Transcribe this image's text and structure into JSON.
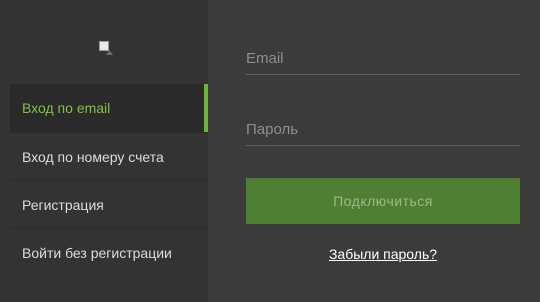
{
  "sidebar": {
    "logo": "broken-image-icon",
    "items": [
      {
        "label": "Вход по email",
        "active": true
      },
      {
        "label": "Вход по номеру счета",
        "active": false
      },
      {
        "label": "Регистрация",
        "active": false
      },
      {
        "label": "Войти без регистрации",
        "active": false
      }
    ]
  },
  "form": {
    "email_placeholder": "Email",
    "password_placeholder": "Пароль",
    "submit_label": "Подключиться",
    "forgot_label": "Забыли пароль?"
  },
  "colors": {
    "background": "#3b3b3b",
    "sidebar": "#333333",
    "accent": "#6eb53c",
    "active_text": "#7fc142",
    "button": "#4f7f33",
    "button_text": "#9cba87"
  }
}
